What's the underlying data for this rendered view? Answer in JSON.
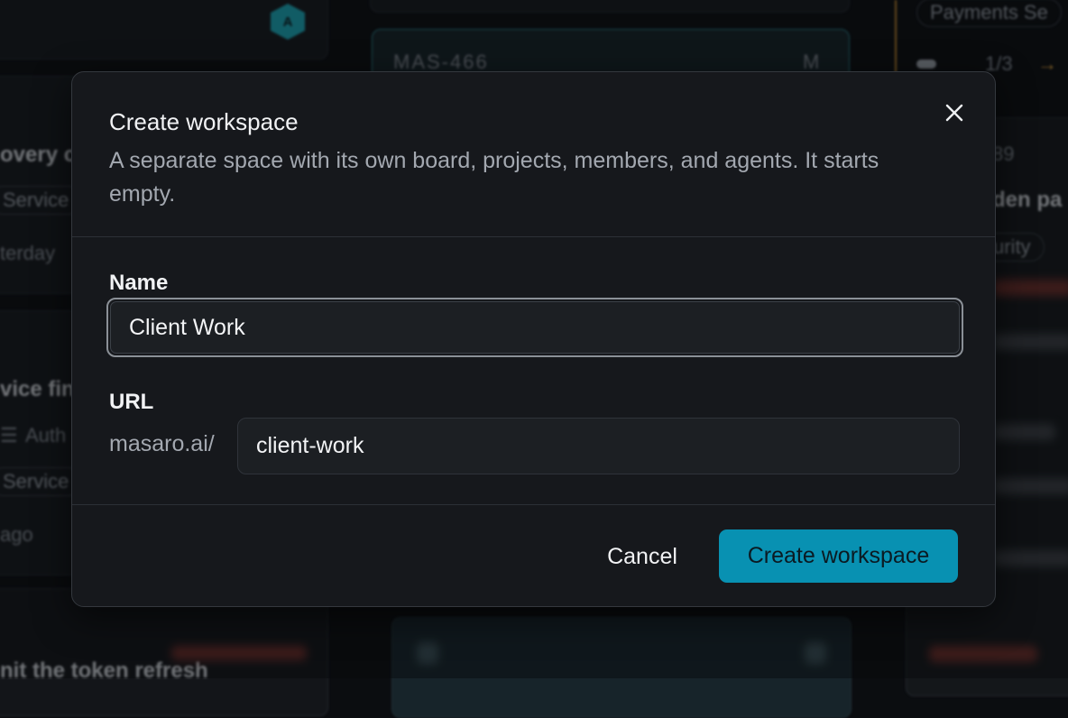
{
  "background": {
    "card_top_avatar": "A",
    "card_recovery_title": "overy c",
    "card_recovery_tag": "Service",
    "card_recovery_time": "terday",
    "card_service_title": "vice fin",
    "card_service_tag_icon": "list-icon",
    "card_service_tag": "Auth",
    "card_service_tag2": "Service",
    "card_service_time": "ago",
    "card_bottom_title": "nit the token refresh",
    "issue_id": "MAS-466",
    "issue_assignee": "M",
    "right_tag": "Payments Se",
    "right_progress": "1/3",
    "right_arrow": "→",
    "right_number": "89",
    "right_title": "den pa",
    "right_tag2": "urity"
  },
  "modal": {
    "title": "Create workspace",
    "description": "A separate space with its own board, projects, members, and agents. It starts empty.",
    "close_icon": "close-icon",
    "name_label": "Name",
    "name_value": "Client Work",
    "url_label": "URL",
    "url_prefix": "masaro.ai/",
    "url_value": "client-work",
    "cancel_label": "Cancel",
    "create_label": "Create workspace",
    "accent_color": "#0891b2"
  }
}
